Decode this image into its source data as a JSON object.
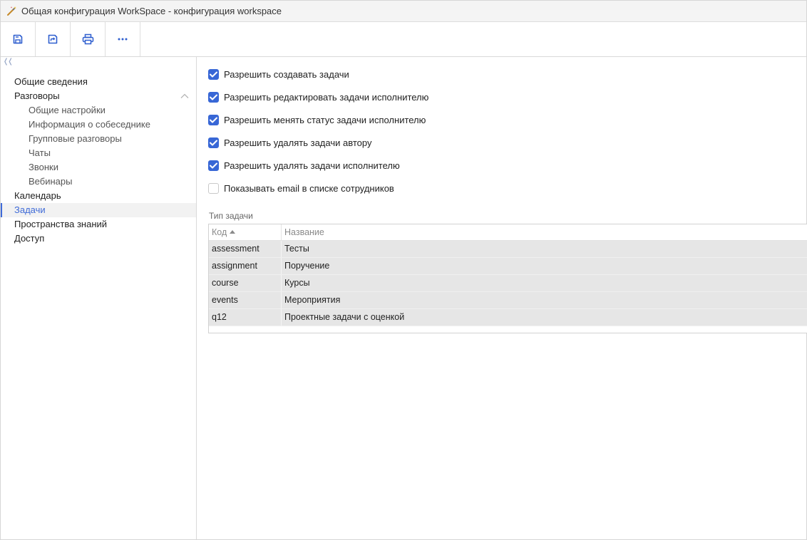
{
  "window": {
    "title": "Общая конфигурация WorkSpace - конфигурация workspace",
    "title_icon": "magic-wand-icon"
  },
  "toolbar": {
    "buttons": [
      {
        "icon": "save-icon"
      },
      {
        "icon": "save-and-close-icon"
      },
      {
        "icon": "print-icon"
      },
      {
        "icon": "more-icon"
      }
    ]
  },
  "sidebar": {
    "collapse_icon": "double-chevron-left-icon",
    "items": [
      {
        "label": "Общие сведения"
      },
      {
        "label": "Разговоры",
        "expanded": true
      },
      {
        "label": "Общие настройки"
      },
      {
        "label": "Информация о собеседнике"
      },
      {
        "label": "Групповые разговоры"
      },
      {
        "label": "Чаты"
      },
      {
        "label": "Звонки"
      },
      {
        "label": "Вебинары"
      },
      {
        "label": "Календарь"
      },
      {
        "label": "Задачи",
        "active": true
      },
      {
        "label": "Пространства знаний"
      },
      {
        "label": "Доступ"
      }
    ]
  },
  "settings": {
    "checkboxes": [
      {
        "label": "Разрешить создавать задачи",
        "checked": true
      },
      {
        "label": "Разрешить редактировать задачи исполнителю",
        "checked": true
      },
      {
        "label": "Разрешить менять статус задачи исполнителю",
        "checked": true
      },
      {
        "label": "Разрешить удалять задачи автору",
        "checked": true
      },
      {
        "label": "Разрешить удалять задачи исполнителю",
        "checked": true
      },
      {
        "label": "Показывать email в списке сотрудников",
        "checked": false
      }
    ],
    "task_type": {
      "label": "Тип задачи",
      "columns": [
        "Код",
        "Название"
      ],
      "sort_column": "Код",
      "rows": [
        [
          "assessment",
          "Тесты"
        ],
        [
          "assignment",
          "Поручение"
        ],
        [
          "course",
          "Курсы"
        ],
        [
          "events",
          "Мероприятия"
        ],
        [
          "q12",
          "Проектные задачи с оценкой"
        ]
      ]
    }
  },
  "colors": {
    "accent": "#3867d6",
    "active_nav": "#3f6bd8",
    "row_bg": "#e6e6e6"
  }
}
